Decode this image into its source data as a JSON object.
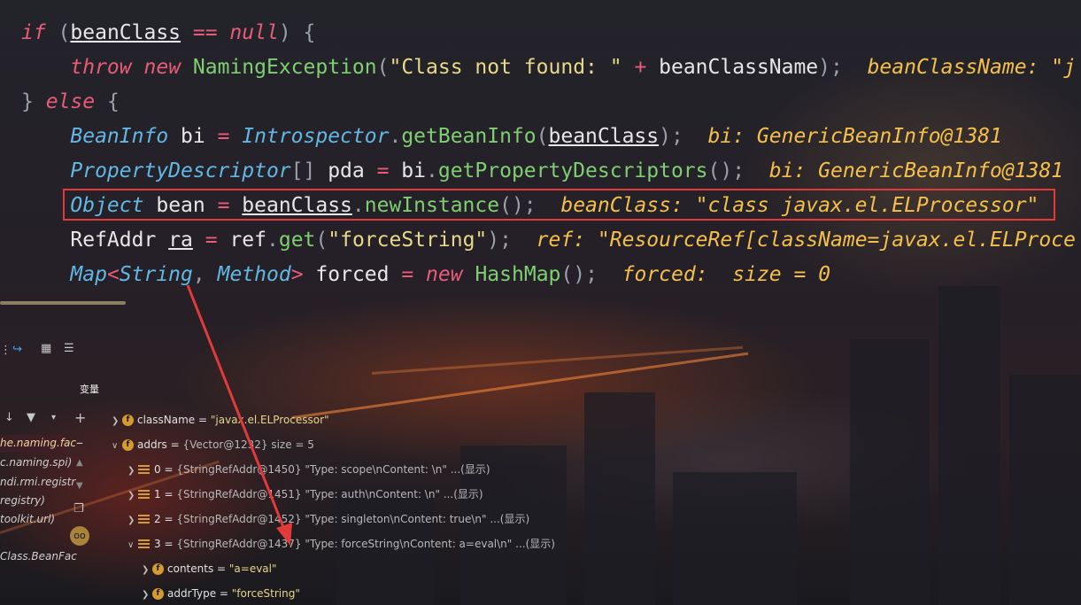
{
  "code": {
    "l1": {
      "kw_if": "if",
      "p1": " (",
      "var": "beanClass",
      "eq": " == ",
      "nul": "null",
      "p2": ") {"
    },
    "l2": {
      "kw_throw": "throw",
      "kw_new": "new",
      "cls": "NamingException",
      "p1": "(",
      "str": "\"Class not found: \"",
      "plus": " + ",
      "var": "beanClassName",
      "p2": ");",
      "hint": "beanClassName: \"j"
    },
    "l3": {
      "br": "}",
      "kw_else": "else",
      "br2": "{"
    },
    "l4": {
      "type": "BeanInfo",
      "var": "bi",
      "eq": " = ",
      "cls": "Introspector",
      "dot": ".",
      "fn": "getBeanInfo",
      "p1": "(",
      "arg": "beanClass",
      "p2": ");",
      "hint": "bi: GenericBeanInfo@1381"
    },
    "l5": {
      "type": "PropertyDescriptor",
      "arr": "[]",
      "var": "pda",
      "eq": " = ",
      "obj": "bi",
      "dot": ".",
      "fn": "getPropertyDescriptors",
      "p": "();",
      "hint": "bi: GenericBeanInfo@1381"
    },
    "l6": {
      "type": "Object",
      "var": "bean",
      "eq": " = ",
      "obj": "beanClass",
      "dot": ".",
      "fn": "newInstance",
      "p": "();",
      "hint": "beanClass: \"class javax.el.ELProcessor\""
    },
    "l7": {
      "type": "RefAddr",
      "var": "ra",
      "eq": " = ",
      "obj": "ref",
      "dot": ".",
      "fn": "get",
      "p1": "(",
      "str": "\"forceString\"",
      "p2": ");",
      "hint": "ref: \"ResourceRef[className=javax.el.ELProce"
    },
    "l8": {
      "type": "Map",
      "lt": "<",
      "t1": "String",
      "comma": ", ",
      "t2": "Method",
      "gt": ">",
      "var": "forced",
      "eq": " = ",
      "kw_new": "new",
      "cls": "HashMap",
      "p": "();",
      "hint": "forced:  size = 0"
    }
  },
  "debugger": {
    "variables_label": "变量",
    "left_frames": [
      "he.naming.fac",
      "c.naming.spi)",
      "ndi.rmi.registr",
      "registry)",
      "toolkit.url)",
      "Class.BeanFac"
    ]
  },
  "variables": [
    {
      "name": "className",
      "eq": " = ",
      "value": "\"javax.el.ELProcessor\"",
      "icon": "field-icon"
    },
    {
      "name": "addrs",
      "eq": " = ",
      "value": "{Vector@1232}  size = 5",
      "icon": "field-icon"
    },
    {
      "name": "0",
      "eq": " = ",
      "ref": "{StringRefAddr@1450}",
      "value": "\"Type: scope\\nContent: \\n\"",
      "more": "...(显示)",
      "icon": "list-icon"
    },
    {
      "name": "1",
      "eq": " = ",
      "ref": "{StringRefAddr@1451}",
      "value": "\"Type: auth\\nContent: \\n\"",
      "more": "...(显示)",
      "icon": "list-icon"
    },
    {
      "name": "2",
      "eq": " = ",
      "ref": "{StringRefAddr@1452}",
      "value": "\"Type: singleton\\nContent: true\\n\"",
      "more": "...(显示)",
      "icon": "list-icon"
    },
    {
      "name": "3",
      "eq": " = ",
      "ref": "{StringRefAddr@1437}",
      "value": "\"Type: forceString\\nContent: a=eval\\n\"",
      "more": "...(显示)",
      "icon": "list-icon"
    },
    {
      "name": "contents",
      "eq": " = ",
      "value": "\"a=eval\"",
      "icon": "field-icon"
    },
    {
      "name": "addrType",
      "eq": " = ",
      "value": "\"forceString\"",
      "icon": "field-icon"
    }
  ],
  "colors": {
    "highlight_border": "#e23a3a",
    "annotation_arrow": "#e23a3a",
    "hint": "#f5c04a"
  }
}
